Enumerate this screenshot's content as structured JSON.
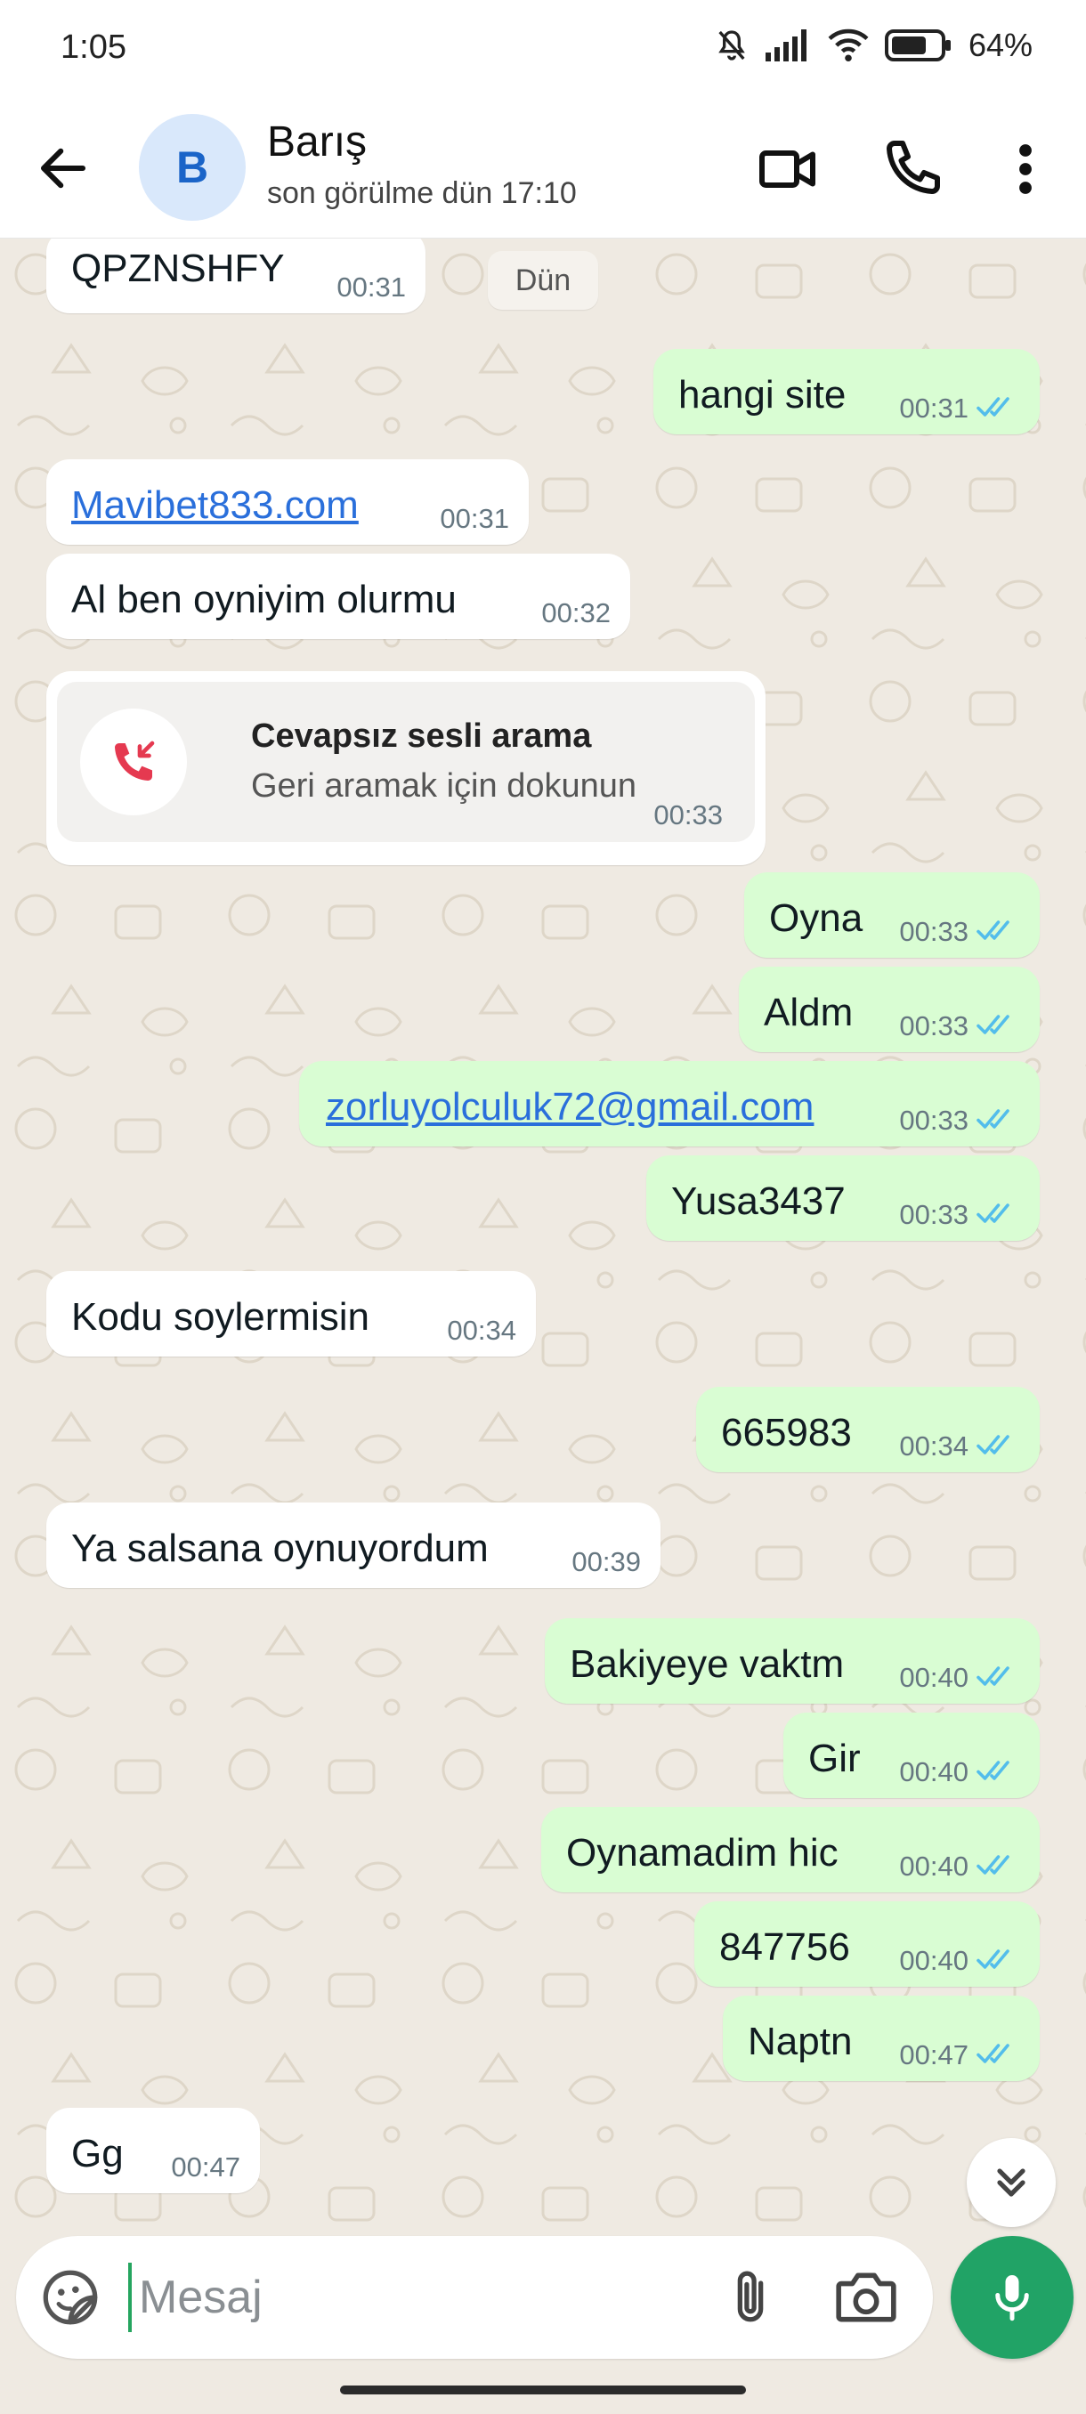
{
  "status_bar": {
    "time": "1:05",
    "battery": "64%"
  },
  "header": {
    "avatar_letter": "B",
    "name": "Barış",
    "last_seen": "son görülme dün 17:10"
  },
  "date_chip": "Dün",
  "messages": [
    {
      "dir": "in",
      "text": "QPZNSHFY",
      "time": "00:31"
    },
    {
      "dir": "out",
      "text": "hangi site",
      "time": "00:31"
    },
    {
      "dir": "in",
      "text": "Mavibet833.com",
      "time": "00:31",
      "link": true
    },
    {
      "dir": "in",
      "text": "Al ben oyniyim olurmu",
      "time": "00:32"
    },
    {
      "dir": "out",
      "text": "Oyna",
      "time": "00:33"
    },
    {
      "dir": "out",
      "text": "Aldm",
      "time": "00:33"
    },
    {
      "dir": "out",
      "text": "zorluyolculuk72@gmail.com",
      "time": "00:33",
      "link": true
    },
    {
      "dir": "out",
      "text": "Yusa3437",
      "time": "00:33"
    },
    {
      "dir": "in",
      "text": "Kodu soylermisin",
      "time": "00:34"
    },
    {
      "dir": "out",
      "text": "665983",
      "time": "00:34"
    },
    {
      "dir": "in",
      "text": "Ya salsana oynuyordum",
      "time": "00:39"
    },
    {
      "dir": "out",
      "text": "Bakiyeye vaktm",
      "time": "00:40"
    },
    {
      "dir": "out",
      "text": "Gir",
      "time": "00:40"
    },
    {
      "dir": "out",
      "text": "Oynamadim hic",
      "time": "00:40"
    },
    {
      "dir": "out",
      "text": "847756",
      "time": "00:40"
    },
    {
      "dir": "out",
      "text": "Naptn",
      "time": "00:47"
    },
    {
      "dir": "in",
      "text": "Gg",
      "time": "00:47"
    }
  ],
  "missed_call": {
    "title": "Cevapsız sesli arama",
    "subtitle": "Geri aramak için dokunun",
    "time": "00:33"
  },
  "composer": {
    "placeholder": "Mesaj"
  },
  "colors": {
    "outgoing_bubble": "#d9fdd3",
    "incoming_bubble": "#ffffff",
    "chat_background": "#efeae2",
    "read_ticks": "#53bdeb",
    "mic_button": "#21a366",
    "missed_call_icon": "#e53950"
  },
  "icons": {
    "back": "arrow-left-icon",
    "video": "video-camera-icon",
    "call": "phone-icon",
    "menu": "more-vertical-icon",
    "sticker": "sticker-icon",
    "attach": "paperclip-icon",
    "camera": "camera-icon",
    "mic": "microphone-icon",
    "scroll": "double-chevron-down-icon"
  }
}
